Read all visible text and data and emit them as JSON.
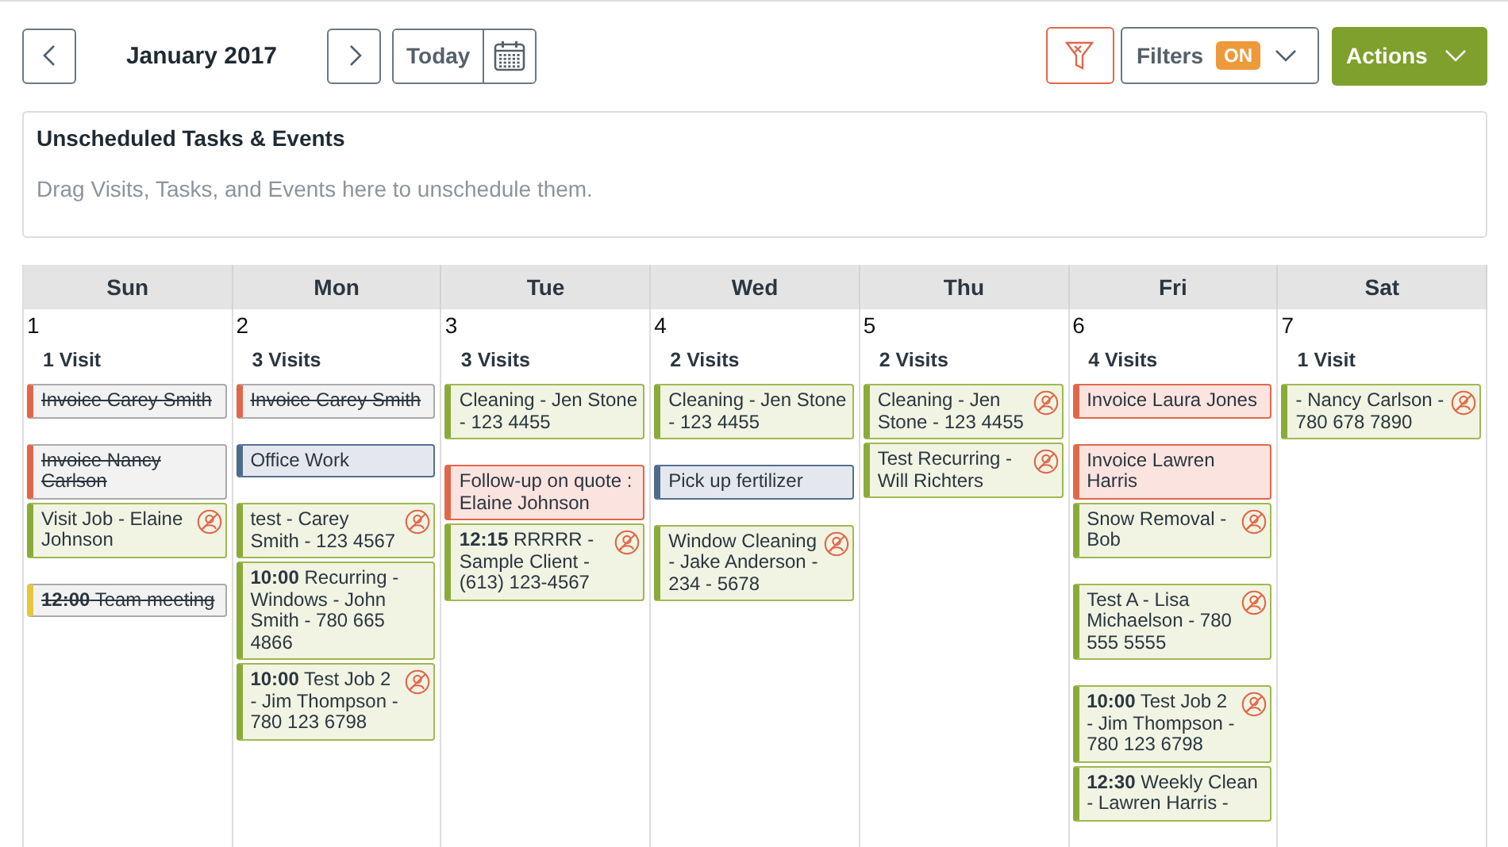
{
  "toolbar": {
    "month": "January 2017",
    "today": "Today",
    "filters": {
      "label": "Filters",
      "badge": "ON"
    },
    "actions": "Actions"
  },
  "unscheduled": {
    "title": "Unscheduled Tasks & Events",
    "hint": "Drag Visits, Tasks, and Events here to unschedule them."
  },
  "days": [
    {
      "name": "Sun",
      "date": "1",
      "count": "1 Visit",
      "events": [
        {
          "kind": "invoice",
          "text": "Invoice Carey Smith",
          "done": true,
          "unassigned": false
        },
        {
          "kind": "gap"
        },
        {
          "kind": "invoice",
          "text": "Invoice Nancy Carlson",
          "done": true,
          "unassigned": false
        },
        {
          "kind": "visit",
          "text": "Visit Job - Elaine Johnson",
          "done": false,
          "unassigned": true
        },
        {
          "kind": "gap"
        },
        {
          "kind": "event",
          "text": "**12:00** Team meeting",
          "done": true,
          "unassigned": false
        }
      ]
    },
    {
      "name": "Mon",
      "date": "2",
      "count": "3 Visits",
      "events": [
        {
          "kind": "invoice",
          "text": "Invoice Carey Smith",
          "done": true,
          "unassigned": false
        },
        {
          "kind": "gap"
        },
        {
          "kind": "task",
          "text": "Office Work",
          "done": false,
          "unassigned": false
        },
        {
          "kind": "gap"
        },
        {
          "kind": "visit",
          "text": "test - Carey Smith - 123 4567",
          "done": false,
          "unassigned": true
        },
        {
          "kind": "visit",
          "text": "**10:00** Recurring - Windows - John Smith - 780 665 4866",
          "done": false,
          "unassigned": false
        },
        {
          "kind": "visit",
          "text": "**10:00** Test Job 2 - Jim Thompson - 780 123 6798",
          "done": false,
          "unassigned": true
        }
      ]
    },
    {
      "name": "Tue",
      "date": "3",
      "count": "3 Visits",
      "events": [
        {
          "kind": "visit",
          "text": "Cleaning - Jen Stone - 123 4455",
          "done": false,
          "unassigned": false
        },
        {
          "kind": "gap"
        },
        {
          "kind": "invoice",
          "text": "Follow-up on quote : Elaine Johnson",
          "done": false,
          "unassigned": false
        },
        {
          "kind": "visit",
          "text": "**12:15** RRRRR - Sample Client - (613) 123-4567",
          "done": false,
          "unassigned": true
        }
      ]
    },
    {
      "name": "Wed",
      "date": "4",
      "count": "2 Visits",
      "events": [
        {
          "kind": "visit",
          "text": "Cleaning - Jen Stone - 123 4455",
          "done": false,
          "unassigned": false
        },
        {
          "kind": "gap"
        },
        {
          "kind": "task",
          "text": "Pick up fertilizer",
          "done": false,
          "unassigned": false
        },
        {
          "kind": "gap"
        },
        {
          "kind": "visit",
          "text": "Window Cleaning - Jake Anderson - 234 - 5678",
          "done": false,
          "unassigned": true
        }
      ]
    },
    {
      "name": "Thu",
      "date": "5",
      "count": "2 Visits",
      "events": [
        {
          "kind": "visit",
          "text": "Cleaning - Jen Stone - 123 4455",
          "done": false,
          "unassigned": true
        },
        {
          "kind": "visit",
          "text": "Test Recurring - Will Richters",
          "done": false,
          "unassigned": true
        }
      ]
    },
    {
      "name": "Fri",
      "date": "6",
      "count": "4 Visits",
      "events": [
        {
          "kind": "invoice",
          "text": "Invoice Laura Jones",
          "done": false,
          "unassigned": false
        },
        {
          "kind": "gap"
        },
        {
          "kind": "invoice",
          "text": "Invoice Lawren Harris",
          "done": false,
          "unassigned": false
        },
        {
          "kind": "visit",
          "text": "Snow Removal - Bob",
          "done": false,
          "unassigned": true
        },
        {
          "kind": "gap"
        },
        {
          "kind": "visit",
          "text": "Test A - Lisa Michaelson - 780 555 5555",
          "done": false,
          "unassigned": true
        },
        {
          "kind": "gap"
        },
        {
          "kind": "visit",
          "text": "**10:00** Test Job 2 - Jim Thompson - 780 123 6798",
          "done": false,
          "unassigned": true
        },
        {
          "kind": "visit",
          "text": "**12:30** Weekly Clean - Lawren Harris -",
          "done": false,
          "unassigned": false
        }
      ]
    },
    {
      "name": "Sat",
      "date": "7",
      "count": "1 Visit",
      "events": [
        {
          "kind": "visit",
          "text": "- Nancy Carlson - 780 678 7890",
          "done": false,
          "unassigned": true
        }
      ]
    }
  ]
}
